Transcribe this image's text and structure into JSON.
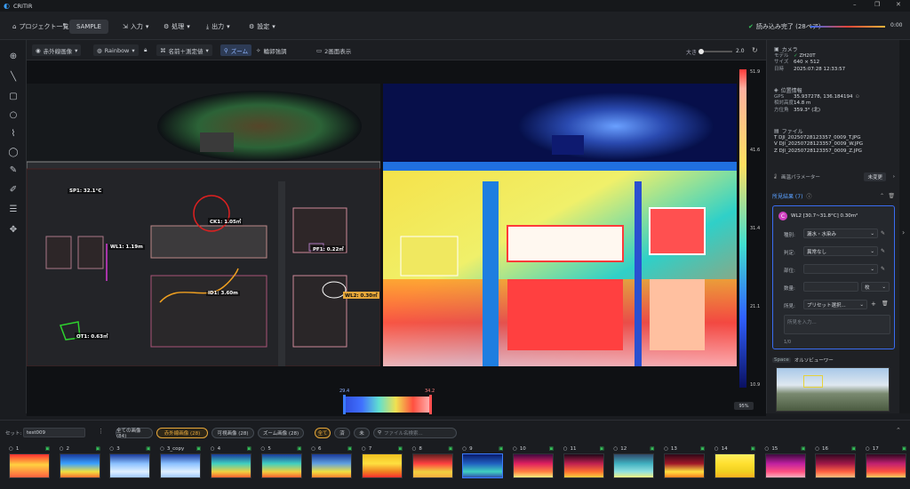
{
  "app": {
    "title": "CRITIR"
  },
  "window_controls": {
    "minimize": "–",
    "maximize": "❐",
    "close": "✕"
  },
  "menu": {
    "project_list": "プロジェクト一覧",
    "project_name": "SAMPLE",
    "input": "入力",
    "process": "処理",
    "output": "出力",
    "settings": "設定",
    "status": "読み込み完了 (28ペア)",
    "progress_time": "0:00",
    "progress_fraction": 1.0
  },
  "toolbar": {
    "image_type": "赤外線画像",
    "palette": "Rainbow",
    "label_mode": "名前＋測定値",
    "zoom_tag": "ズーム",
    "contour": "輪郭強調",
    "dual_view": "2画面表示",
    "size_label": "大き",
    "size_value": "2.0",
    "size_fraction": 0.08
  },
  "annotations": {
    "sp1": "SP1: 32.1°C",
    "ck1": "CK1: 1.05㎡",
    "wl1": "WL1: 1.19m",
    "pf1": "PF1: 0.22㎡",
    "id1": "ID1: 3.60m",
    "wl2": "WL2: 0.30㎡",
    "ot1": "OT1: 0.63㎡"
  },
  "scale": {
    "ticks": [
      "51.9",
      "41.6",
      "31.4",
      "21.1",
      "10.9"
    ],
    "range_min": "29.4",
    "range_max": "34.2",
    "zoom": "95%"
  },
  "panel": {
    "camera": {
      "header": "カメラ",
      "model_label": "モデル",
      "model": "ZH20T",
      "size_label": "サイズ",
      "size": "640 × 512",
      "date_label": "日時",
      "date": "2025:07:28 12:33:57"
    },
    "location": {
      "header": "位置情報",
      "gps_label": "GPS",
      "gps": "35.937278, 136.184194",
      "alt_label": "相対高度",
      "alt": "14.8 m",
      "dir_label": "方位角",
      "dir": "359.3° (北)"
    },
    "files": {
      "header": "ファイル",
      "items": [
        "T  DJI_20250728123357_0009_T.JPG",
        "V  DJI_20250728123357_0009_W.JPG",
        "Z  DJI_20250728123357_0009_Z.JPG"
      ]
    },
    "params": {
      "label": "画温パラメーター",
      "status": "未変更"
    },
    "findings": {
      "header": "所見結果 (7)",
      "badge": "C",
      "title": "WL2 [30.7~31.8°C] 0.30m²",
      "fields": [
        {
          "label": "種別:",
          "value": "漏水・水染み"
        },
        {
          "label": "判定:",
          "value": "異常なし"
        },
        {
          "label": "部位:",
          "value": ""
        },
        {
          "label": "数量:",
          "value": ""
        },
        {
          "label": "所見:",
          "value": "プリセット選択..."
        }
      ],
      "unit": "枚",
      "memo_placeholder": "所見を入力...",
      "counter": "1/0"
    },
    "orthoviewer": {
      "tag": "Space",
      "title": "オルソビューワー"
    }
  },
  "bottom": {
    "set_label": "セット:",
    "set_value": "test009",
    "filters": [
      "全ての画像 (84)",
      "赤外線画像 (28)",
      "可視画像 (28)",
      "ズーム画像 (28)"
    ],
    "status_filters": [
      "全て",
      "済",
      "未"
    ],
    "search_placeholder": "ファイル名検索...",
    "thumbs": [
      "1",
      "2",
      "3",
      "3_copy",
      "4",
      "5",
      "6",
      "7",
      "8",
      "9",
      "10",
      "11",
      "12",
      "13",
      "14",
      "15",
      "16",
      "17"
    ]
  },
  "colors": {
    "accent": "#2f7de1",
    "ok": "#36c25a",
    "warn": "#e6a73a"
  }
}
